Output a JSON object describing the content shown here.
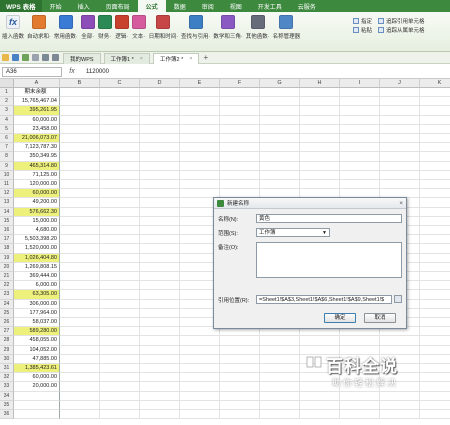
{
  "app": {
    "name": "WPS 表格"
  },
  "menu": [
    "开始",
    "插入",
    "页面布局",
    "公式",
    "数据",
    "审阅",
    "视图",
    "开发工具",
    "云服务"
  ],
  "menu_active": 3,
  "ribbon": {
    "buttons": [
      {
        "label": "插入函数",
        "icon": "fx-icon",
        "color": "#eef2f7"
      },
      {
        "label": "自动求和·",
        "icon": "sum-icon",
        "color": "#e27b2f"
      },
      {
        "label": "常用函数·",
        "icon": "star-function-icon",
        "color": "#3a7bd5"
      },
      {
        "label": "全部·",
        "icon": "all-functions-icon",
        "color": "#8c4db8"
      },
      {
        "label": "财务·",
        "icon": "finance-icon",
        "color": "#2b8a55"
      },
      {
        "label": "逻辑·",
        "icon": "logic-icon",
        "color": "#c8412f"
      },
      {
        "label": "文本·",
        "icon": "text-icon",
        "color": "#d65a9e"
      },
      {
        "label": "日期和时间·",
        "icon": "calendar-icon",
        "color": "#c74646"
      },
      {
        "label": "查找与引用·",
        "icon": "lookup-icon",
        "color": "#3d7fc4"
      },
      {
        "label": "数学和三角·",
        "icon": "math-icon",
        "color": "#8a5ac2"
      },
      {
        "label": "其他函数·",
        "icon": "more-functions-icon",
        "color": "#666c7a"
      },
      {
        "label": "名称管理器",
        "icon": "name-manager-icon",
        "color": "#4f86c6"
      }
    ],
    "right": [
      {
        "label": "指定",
        "icon": "define-icon"
      },
      {
        "label": "追踪引用单元格",
        "icon": "trace-precedents-icon"
      },
      {
        "label": "粘贴",
        "icon": "paste-icon"
      },
      {
        "label": "追踪从属单元格",
        "icon": "trace-dependents-icon"
      }
    ]
  },
  "tabs": [
    {
      "label": "我的WPS",
      "active": false
    },
    {
      "label": "工作簿1 *",
      "active": false
    },
    {
      "label": "工作簿2 *",
      "active": true
    }
  ],
  "formula_bar": {
    "cell_ref": "A36",
    "fx": "fx",
    "value": "1120000"
  },
  "columns": [
    "A",
    "B",
    "C",
    "D",
    "E",
    "F",
    "G",
    "H",
    "I",
    "J",
    "K"
  ],
  "rows": [
    {
      "n": "1",
      "a": "期末余额",
      "hl": false
    },
    {
      "n": "2",
      "a": "15,765,467.04",
      "hl": false
    },
    {
      "n": "3",
      "a": "395,261.95",
      "hl": true
    },
    {
      "n": "4",
      "a": "60,000.00",
      "hl": false
    },
    {
      "n": "5",
      "a": "23,458.00",
      "hl": false
    },
    {
      "n": "6",
      "a": "21,006,073.07",
      "hl": true
    },
    {
      "n": "7",
      "a": "7,123,787.30",
      "hl": false
    },
    {
      "n": "8",
      "a": "350,349.95",
      "hl": false
    },
    {
      "n": "9",
      "a": "465,314.80",
      "hl": true
    },
    {
      "n": "10",
      "a": "71,125.00",
      "hl": false
    },
    {
      "n": "11",
      "a": "120,000.00",
      "hl": false
    },
    {
      "n": "12",
      "a": "60,000.00",
      "hl": true
    },
    {
      "n": "13",
      "a": "49,200.00",
      "hl": false
    },
    {
      "n": "14",
      "a": "576,662.30",
      "hl": true
    },
    {
      "n": "15",
      "a": "15,000.00",
      "hl": false
    },
    {
      "n": "16",
      "a": "4,680.00",
      "hl": false
    },
    {
      "n": "17",
      "a": "5,503,398.20",
      "hl": false
    },
    {
      "n": "18",
      "a": "1,520,000.00",
      "hl": false
    },
    {
      "n": "19",
      "a": "1,026,404.80",
      "hl": true
    },
    {
      "n": "20",
      "a": "1,269,808.15",
      "hl": false
    },
    {
      "n": "21",
      "a": "369,444.00",
      "hl": false
    },
    {
      "n": "22",
      "a": "6,000.00",
      "hl": false
    },
    {
      "n": "23",
      "a": "63,305.00",
      "hl": true
    },
    {
      "n": "24",
      "a": "306,000.00",
      "hl": false
    },
    {
      "n": "25",
      "a": "177,964.00",
      "hl": false
    },
    {
      "n": "26",
      "a": "58,037.00",
      "hl": false
    },
    {
      "n": "27",
      "a": "589,280.00",
      "hl": true
    },
    {
      "n": "28",
      "a": "458,055.00",
      "hl": false
    },
    {
      "n": "29",
      "a": "104,052.00",
      "hl": false
    },
    {
      "n": "30",
      "a": "47,885.00",
      "hl": false
    },
    {
      "n": "31",
      "a": "1,385,423.61",
      "hl": true
    },
    {
      "n": "32",
      "a": "60,000.00",
      "hl": false
    },
    {
      "n": "33",
      "a": "20,000.00",
      "hl": false
    },
    {
      "n": "34",
      "a": "",
      "hl": false
    },
    {
      "n": "35",
      "a": "",
      "hl": false
    },
    {
      "n": "36",
      "a": "",
      "hl": false
    }
  ],
  "dialog": {
    "title": "新建名称",
    "close": "×",
    "name_label": "名称(N):",
    "name_value": "黄色",
    "scope_label": "范围(S):",
    "scope_value": "工作簿",
    "remark_label": "备注(O):",
    "remark_value": "",
    "ref_label": "引用位置(R):",
    "ref_value": "=Sheet1!$A$3,Sheet1!$A$6,Sheet1!$A$9,Sheet1!$",
    "ok": "确定",
    "cancel": "取消"
  },
  "watermark": {
    "title": "百科全说",
    "subtitle": "助你轻松解决"
  }
}
